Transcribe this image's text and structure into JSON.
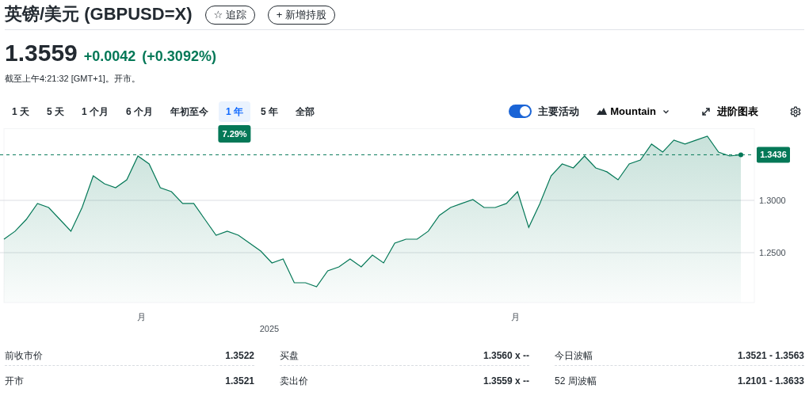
{
  "header": {
    "title": "英镑/美元 (GBPUSD=X)",
    "buttons": [
      {
        "icon_char": "☆",
        "label": "追踪"
      },
      {
        "icon_char": "+",
        "label": "新增持股"
      }
    ]
  },
  "quote": {
    "price": "1.3559",
    "change": "+0.0042",
    "change_percent": "(+0.3092%)",
    "timestamp": "截至上午4:21:32 [GMT+1]。开市。"
  },
  "ranges": [
    {
      "label": "1 天",
      "selected": false
    },
    {
      "label": "5 天",
      "selected": false
    },
    {
      "label": "1 个月",
      "selected": false
    },
    {
      "label": "6 个月",
      "selected": false
    },
    {
      "label": "年初至今",
      "selected": false
    },
    {
      "label": "1 年",
      "selected": true
    },
    {
      "label": "5 年",
      "selected": false
    },
    {
      "label": "全部",
      "selected": false
    }
  ],
  "range_return": "7.29%",
  "toolbar": {
    "key_events": {
      "label": "主要活动",
      "on": true
    },
    "chart_type": "Mountain",
    "advanced_chart": "进阶图表"
  },
  "chart": {
    "x_labels": [
      "月",
      "月"
    ],
    "year_label": "2025",
    "chart_data": {
      "type": "area",
      "ylim": [
        1.2023,
        1.3689
      ],
      "yticks": [
        {
          "value": 1.25,
          "label": "1.2500"
        },
        {
          "value": 1.3,
          "label": "1.3000"
        }
      ],
      "ref_lines": [
        {
          "axis": "y",
          "value": 1.3436,
          "label": "1.3436"
        }
      ],
      "series": [
        {
          "color": "#047857",
          "values": [
            1.2629,
            1.2705,
            1.2818,
            1.297,
            1.2932,
            1.2818,
            1.2705,
            1.2932,
            1.3235,
            1.3159,
            1.3121,
            1.3197,
            1.3424,
            1.3348,
            1.3121,
            1.3083,
            1.297,
            1.297,
            1.2818,
            1.2667,
            1.2705,
            1.2667,
            1.2591,
            1.2515,
            1.2402,
            1.244,
            1.2212,
            1.2212,
            1.2174,
            1.2326,
            1.2364,
            1.244,
            1.2364,
            1.2477,
            1.2402,
            1.2591,
            1.2629,
            1.2629,
            1.2705,
            1.2856,
            1.2932,
            1.297,
            1.3008,
            1.2932,
            1.2932,
            1.297,
            1.3083,
            1.2742,
            1.297,
            1.3235,
            1.3348,
            1.331,
            1.3424,
            1.331,
            1.3273,
            1.3197,
            1.3348,
            1.3386,
            1.3538,
            1.3462,
            1.3576,
            1.3538,
            1.3576,
            1.3614,
            1.3462,
            1.3424,
            1.3436
          ]
        }
      ]
    }
  },
  "stats": [
    [
      {
        "label": "前收市价",
        "value": "1.3522"
      },
      {
        "label": "开市",
        "value": "1.3521"
      }
    ],
    [
      {
        "label": "买盘",
        "value": "1.3560 x --"
      },
      {
        "label": "卖出价",
        "value": "1.3559 x --"
      }
    ],
    [
      {
        "label": "今日波幅",
        "value": "1.3521 - 1.3563"
      },
      {
        "label": "52 周波幅",
        "value": "1.2101 - 1.3633"
      }
    ]
  ]
}
